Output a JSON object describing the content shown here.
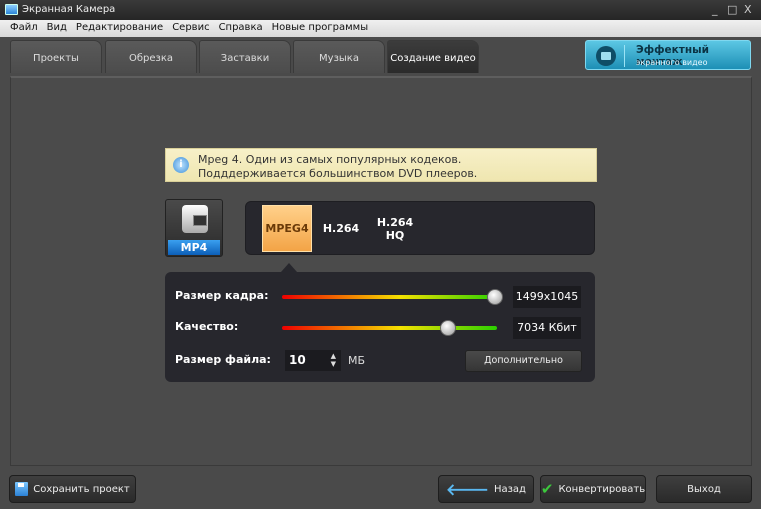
{
  "window": {
    "title": "Экранная Камера",
    "controls": [
      "_",
      "□",
      "X"
    ]
  },
  "menu": [
    "Файл",
    "Вид",
    "Редактирование",
    "Сервис",
    "Справка",
    "Новые программы"
  ],
  "tabs": [
    {
      "label": "Проекты"
    },
    {
      "label": "Обрезка"
    },
    {
      "label": "Заставки"
    },
    {
      "label": "Музыка"
    },
    {
      "label": "Создание видео",
      "active": true
    }
  ],
  "promo": {
    "title": "Эффектный монтаж",
    "subtitle": "экранного видео",
    "icon": "clapper-icon"
  },
  "info": {
    "line1": "Mpeg 4. Один из самых популярных кодеков.",
    "line2": "Подддерживается большинством DVD плееров.",
    "icon": "i"
  },
  "format": {
    "label": "MP4",
    "icon": "camcorder-icon"
  },
  "codecs": [
    {
      "label": "MPEG4",
      "selected": true
    },
    {
      "label": "H.264"
    },
    {
      "label": "H.264 HQ"
    }
  ],
  "settings": {
    "frame_size": {
      "label": "Размер кадра:",
      "value": "1499x1045",
      "slider_fraction": 0.99
    },
    "quality": {
      "label": "Качество:",
      "value": "7034 Кбит",
      "slider_fraction": 0.77
    },
    "file_size": {
      "label": "Размер файла:",
      "value": "10",
      "unit": "МБ"
    },
    "more_button": "Дополнительно"
  },
  "footer": {
    "save": "Сохранить проект",
    "back": "Назад",
    "convert": "Конвертировать",
    "exit": "Выход"
  }
}
